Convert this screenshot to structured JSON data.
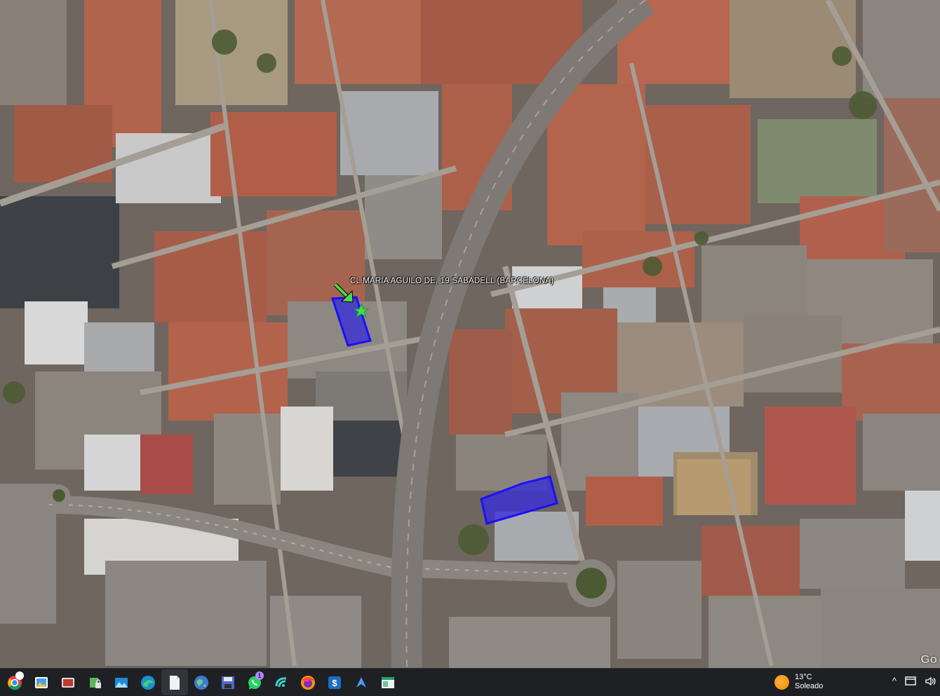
{
  "map": {
    "placemark_label": "CL MARIA AGUILO DE, 19  SABADELL (BARCELONA)",
    "watermark": "Go",
    "colors": {
      "parcel_fill": "#3a2fd6",
      "parcel_stroke": "#1a10ff",
      "placemark_arrow": "#4fd84a",
      "roof_terracotta": "#b8654d",
      "roof_grey": "#8e8a86",
      "road": "#9b958d"
    }
  },
  "taskbar": {
    "apps": [
      {
        "name": "chrome-icon",
        "active": false
      },
      {
        "name": "gallery-icon",
        "active": false
      },
      {
        "name": "photos-icon",
        "active": false
      },
      {
        "name": "recycle-lock-icon",
        "active": false
      },
      {
        "name": "landscape-icon",
        "active": false
      },
      {
        "name": "edge-icon",
        "active": false
      },
      {
        "name": "document-icon",
        "active": true
      },
      {
        "name": "google-earth-icon",
        "active": false
      },
      {
        "name": "save-disk-icon",
        "active": false
      },
      {
        "name": "whatsapp-icon",
        "active": false,
        "badge": "1"
      },
      {
        "name": "wave-app-icon",
        "active": false
      },
      {
        "name": "firefox-icon",
        "active": false
      },
      {
        "name": "dollar-app-icon",
        "active": false
      },
      {
        "name": "arrow-app-icon",
        "active": false
      },
      {
        "name": "spreadsheet-icon",
        "active": false
      }
    ],
    "weather": {
      "temperature": "13°C",
      "condition": "Soleado",
      "icon": "sun-icon"
    },
    "tray": {
      "chevron": "^",
      "icons": [
        "window-icon",
        "speaker-icon"
      ]
    }
  }
}
